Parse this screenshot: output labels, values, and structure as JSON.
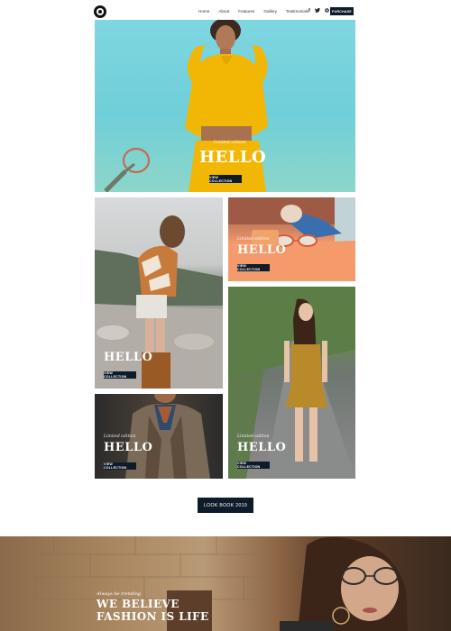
{
  "header": {
    "nav": [
      "Home",
      "About",
      "Features",
      "Gallery",
      "Testimonials"
    ],
    "social": [
      "f",
      "t",
      "p"
    ],
    "purchase_label": "PURCHASE"
  },
  "hero": {
    "eyebrow": "Limited edition",
    "title": "HELLO",
    "cta": "VIEW COLLECTION"
  },
  "tiles": [
    {
      "eyebrow": "",
      "title": "HELLO",
      "cta": "VIEW COLLECTION"
    },
    {
      "eyebrow": "Limited edition",
      "title": "HELLO",
      "cta": "VIEW COLLECTION"
    },
    {
      "eyebrow": "Limited edition",
      "title": "HELLO",
      "cta": "VIEW COLLECTION"
    },
    {
      "eyebrow": "Limited edition",
      "title": "HELLO",
      "cta": "VIEW COLLECTION"
    }
  ],
  "lookbook_label": "LOOK BOOK 2019",
  "banner": {
    "eyebrow": "Always be trending",
    "title_line1": "WE BELIEVE",
    "title_line2": "FASHION IS LIFE"
  },
  "colors": {
    "dark_button": "#0d1b2a",
    "hero_sky": "#7ed6e0",
    "hoodie_yellow": "#f2b705"
  }
}
